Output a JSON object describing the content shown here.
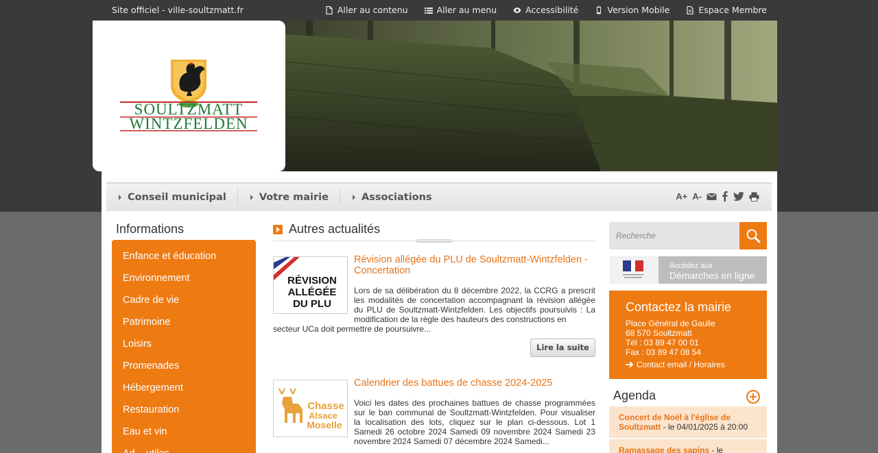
{
  "topbar": {
    "site": "Site officiel - ville-soultzmatt.fr",
    "links": [
      {
        "label": "Aller au contenu",
        "icon": "document-icon"
      },
      {
        "label": "Aller au menu",
        "icon": "list-icon"
      },
      {
        "label": "Accessibilité",
        "icon": "eye-icon"
      },
      {
        "label": "Version Mobile",
        "icon": "mobile-icon"
      },
      {
        "label": "Espace Membre",
        "icon": "document-icon"
      }
    ]
  },
  "logo": {
    "line1": "SOULTZMATT",
    "line2": "WINTZFELDEN"
  },
  "nav": {
    "items": [
      "Conseil municipal",
      "Votre mairie",
      "Associations"
    ],
    "font_plus": "A+",
    "font_minus": "A-"
  },
  "left": {
    "title": "Informations",
    "items": [
      "Enfance et éducation",
      "Environnement",
      "Cadre de vie",
      "Patrimoine",
      "Loisirs",
      "Promenades",
      "Hébergement",
      "Restauration",
      "Eau et vin",
      "Ad... utiles"
    ]
  },
  "center": {
    "title": "Autres actualités",
    "articles": [
      {
        "thumb_lines": [
          "RÉVISION",
          "ALLÉGÉE",
          "DU PLU"
        ],
        "title": "Révision allégée du PLU de Soultzmatt-Wintzfelden - Concertation",
        "text": "Lors de sa délibération du 8 décembre 2022, la CCRG a prescrit les modalités de concertation accompagnant la révision allégée du PLU de Soultzmatt-Wintzfelden. Les objectifs poursuivis : La modification de la règle des hauteurs des constructions en",
        "text_tail": "secteur UCa doit permettre de poursuivre...",
        "button": "Lire la suite"
      },
      {
        "thumb_lines": [
          "Chasse",
          "Alsace",
          "Moselle"
        ],
        "title": "Calendrier des battues de chasse 2024-2025",
        "text": "Voici les dates des prochaines battues de chasse programmées sur le ban communal de Soultzmatt-Wintzfelden. Pour visualiser la localisation des lots, cliquez sur le plan ci-dessous. Lot 1 Samedi 26 octobre 2024 Samedi 09 novembre 2024 Samedi 23 novembre 2024 Samedi 07 décembre 2024 Samedi..."
      }
    ]
  },
  "right": {
    "search_placeholder": "Recherche",
    "demarches_line1": "Accédez aux",
    "demarches_line2": "Démarches en ligne",
    "contact": {
      "title": "Contactez la mairie",
      "lines": [
        "Place Général de Gaulle",
        "68 570 Soultzmatt",
        "Tél : 03 89 47 00 01",
        "Fax : 03 89 47 08 54"
      ],
      "link": "Contact email / Horaires"
    },
    "agenda": {
      "title": "Agenda",
      "events": [
        {
          "title": "Concert de Noël à l'église de Soultzmatt",
          "date": " - le 04/01/2025 à 20:00"
        },
        {
          "title": "Ramassage des sapins",
          "date": " - le"
        }
      ]
    }
  },
  "colors": {
    "accent": "#ee7a12",
    "topbar": "#3a3a3a",
    "link": "#e8741a"
  }
}
